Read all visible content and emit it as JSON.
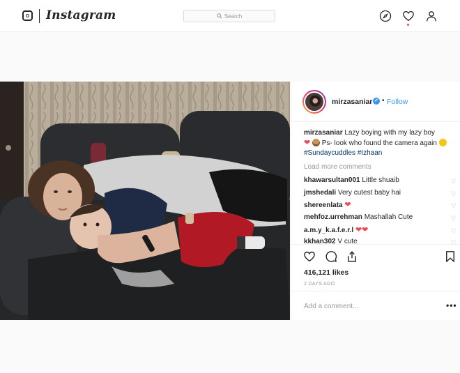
{
  "nav": {
    "wordmark": "Instagram",
    "search_placeholder": "Search"
  },
  "post": {
    "username": "mirzasaniar",
    "follow_label": "Follow",
    "caption": {
      "username": "mirzasaniar",
      "text1": "Lazy boying with my lazy boy",
      "text2": "Ps- look who found the camera again",
      "tag1": "#Sundaycuddles",
      "tag2": "#Izhaan"
    },
    "load_more": "Load more comments",
    "comments": [
      {
        "user": "khawarsultan001",
        "text": "Little shuaib"
      },
      {
        "user": "jmshedali",
        "text": "Very cutest baby hai"
      },
      {
        "user": "shereenlata",
        "text": ""
      },
      {
        "user": "mehfoz.urrehman",
        "text": "Mashallah Cute"
      },
      {
        "user": "a.m.y_k.a.f.e.r.l",
        "text": ""
      },
      {
        "user": "kkhan302",
        "text": "V cute"
      }
    ],
    "likes": "416,121 likes",
    "timestamp": "2 DAYS AGO",
    "add_comment_placeholder": "Add a comment...",
    "more_options": "•••"
  },
  "colors": {
    "link": "#3897f0",
    "heart": "#ed4956",
    "hashtag": "#003569"
  }
}
